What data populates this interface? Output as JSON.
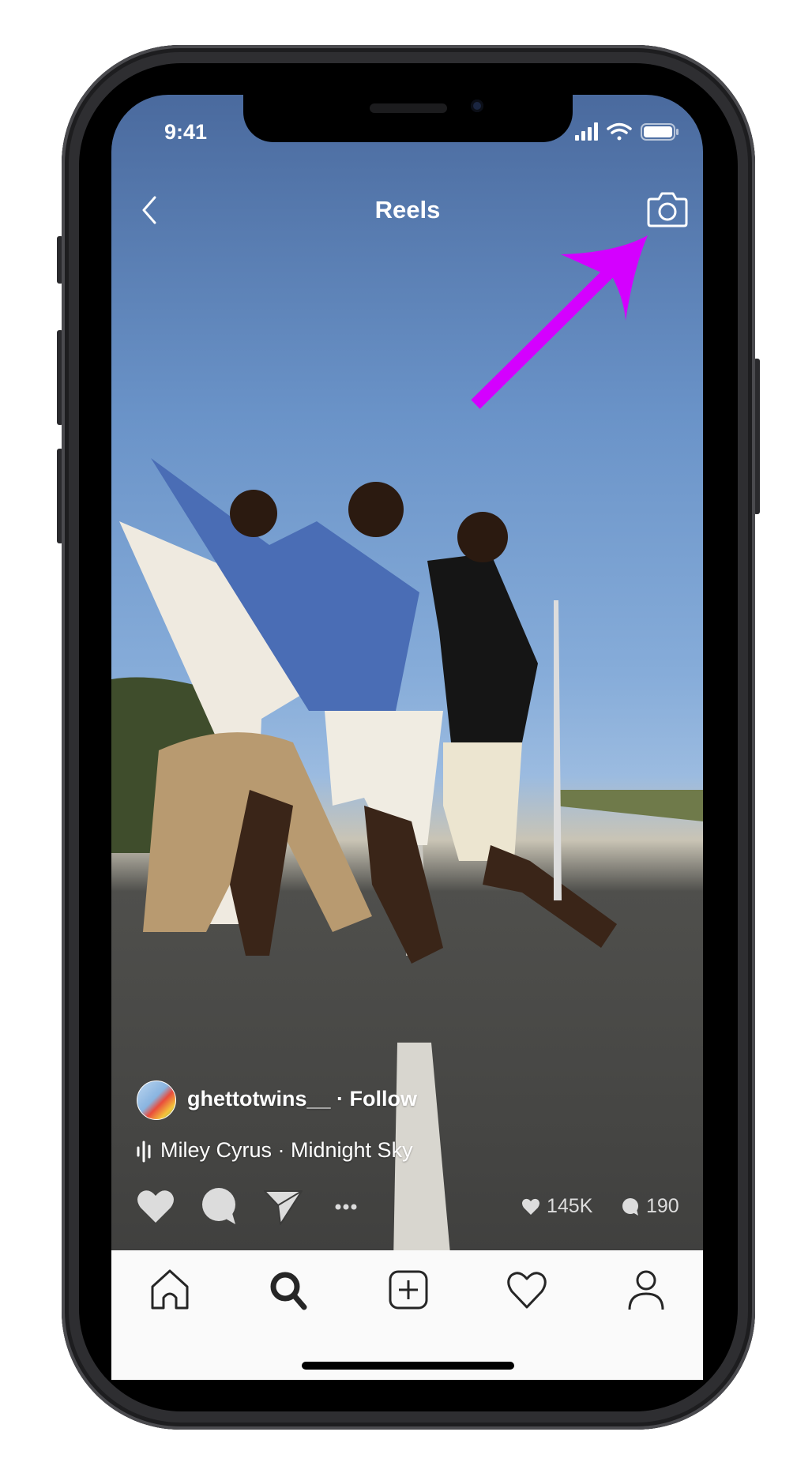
{
  "status_bar": {
    "time": "9:41",
    "icons": [
      "cellular-signal-icon",
      "wifi-icon",
      "battery-icon"
    ]
  },
  "header": {
    "title": "Reels",
    "back_icon": "chevron-left-icon",
    "camera_icon": "camera-icon"
  },
  "annotation": {
    "type": "arrow",
    "color": "#d400ff",
    "points_to": "camera-button"
  },
  "post": {
    "username": "ghettotwins__",
    "separator": "·",
    "follow_label": "Follow",
    "username_line": "ghettotwins__ · Follow",
    "audio": "Miley Cyrus · Midnight Sky",
    "likes": "145K",
    "comments": "190"
  },
  "tab_bar": {
    "items": [
      "home-icon",
      "search-icon",
      "new-post-icon",
      "activity-heart-icon",
      "profile-icon"
    ],
    "active": "search-icon"
  }
}
